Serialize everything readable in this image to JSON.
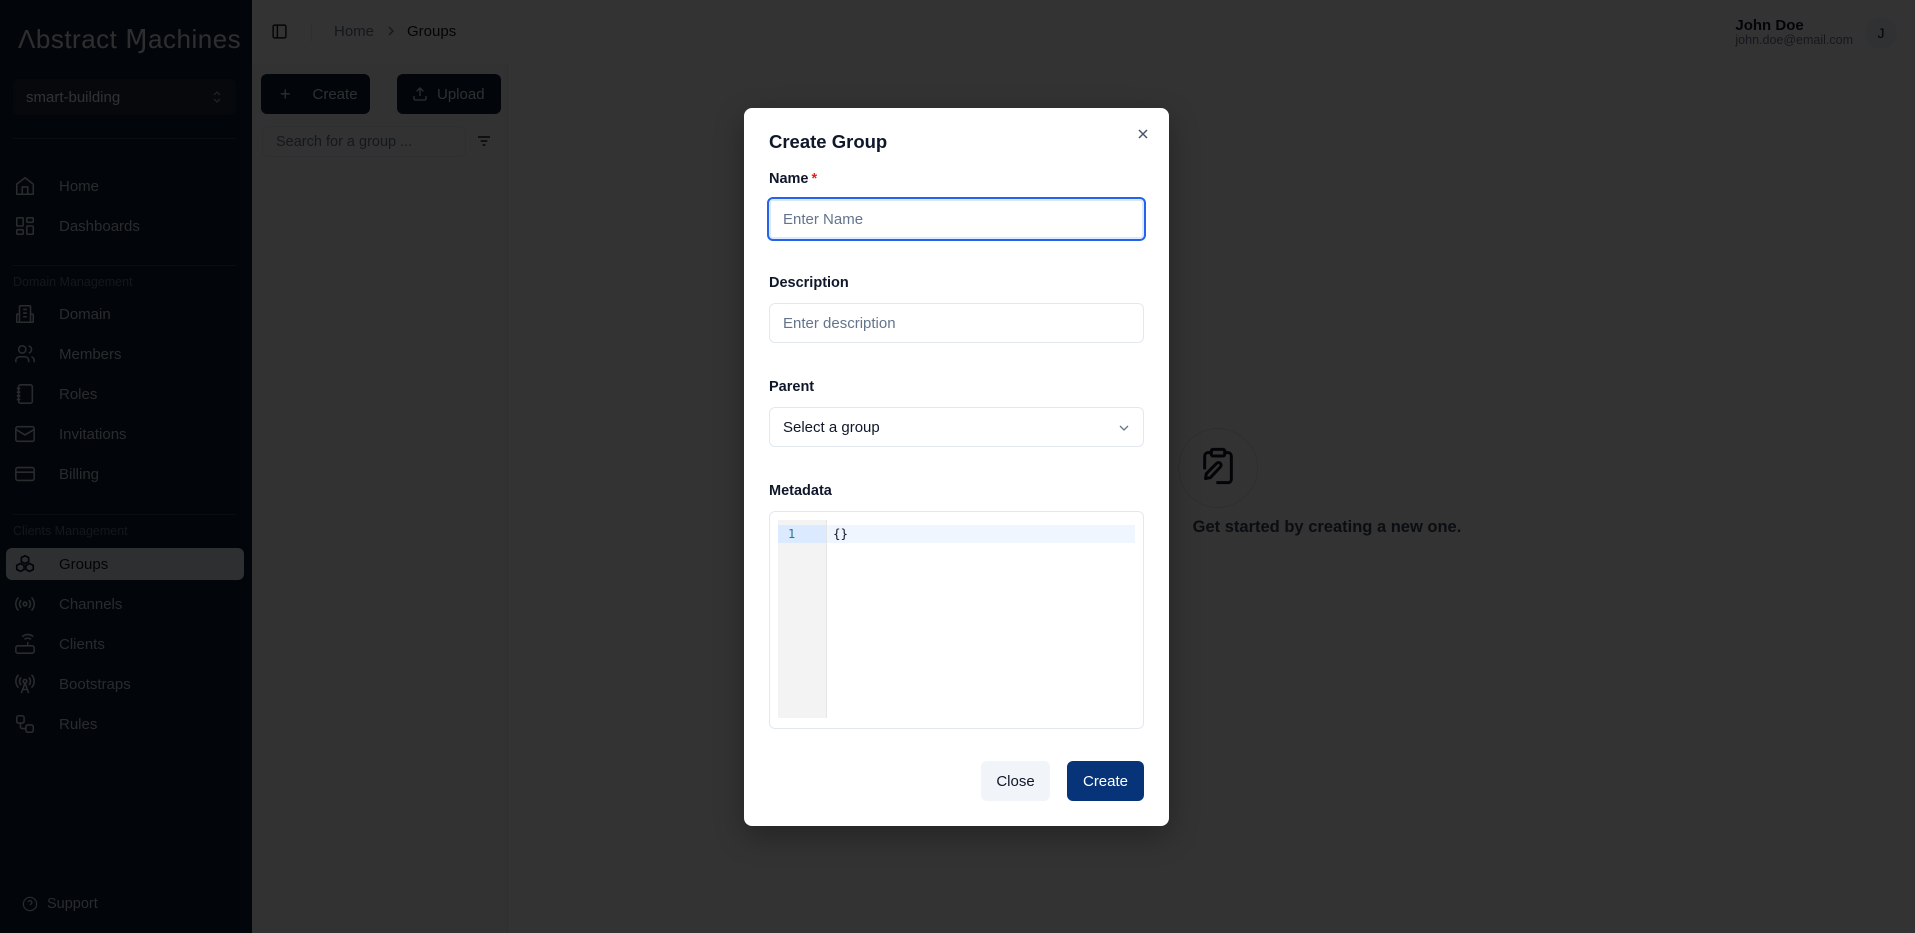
{
  "app": {
    "logo": "Λbstract Ɱachines"
  },
  "sidebar": {
    "domain_selector": "smart-building",
    "top_items": [
      {
        "label": "Home",
        "icon": "home-icon"
      },
      {
        "label": "Dashboards",
        "icon": "dashboard-icon"
      }
    ],
    "sections": [
      {
        "title": "Domain Management",
        "items": [
          {
            "label": "Domain",
            "icon": "building-icon"
          },
          {
            "label": "Members",
            "icon": "users-icon"
          },
          {
            "label": "Roles",
            "icon": "notebook-icon"
          },
          {
            "label": "Invitations",
            "icon": "mail-icon"
          },
          {
            "label": "Billing",
            "icon": "credit-card-icon"
          }
        ]
      },
      {
        "title": "Clients Management",
        "items": [
          {
            "label": "Groups",
            "icon": "boxes-icon",
            "active": true
          },
          {
            "label": "Channels",
            "icon": "radio-icon"
          },
          {
            "label": "Clients",
            "icon": "router-icon"
          },
          {
            "label": "Bootstraps",
            "icon": "antenna-icon"
          },
          {
            "label": "Rules",
            "icon": "workflow-icon"
          }
        ]
      }
    ],
    "support_label": "Support"
  },
  "header": {
    "breadcrumb": [
      "Home",
      "Groups"
    ],
    "user": {
      "name": "John Doe",
      "email": "john.doe@email.com",
      "avatar_initial": "J"
    }
  },
  "toolbar": {
    "create_label": "Create",
    "upload_label": "Upload",
    "search_placeholder": "Search for a group ..."
  },
  "empty_state": {
    "text": "Get started by creating a new one."
  },
  "modal": {
    "title": "Create Group",
    "fields": {
      "name": {
        "label": "Name",
        "required_mark": "*",
        "placeholder": "Enter Name",
        "value": ""
      },
      "description": {
        "label": "Description",
        "placeholder": "Enter description",
        "value": ""
      },
      "parent": {
        "label": "Parent",
        "placeholder": "Select a group"
      },
      "metadata": {
        "label": "Metadata",
        "line_number": "1",
        "content": "{}"
      }
    },
    "close_label": "Close",
    "submit_label": "Create"
  },
  "colors": {
    "sidebar_bg": "#0b1a33",
    "primary": "#073479",
    "focus_ring": "#2563eb",
    "required": "#dc2626"
  }
}
